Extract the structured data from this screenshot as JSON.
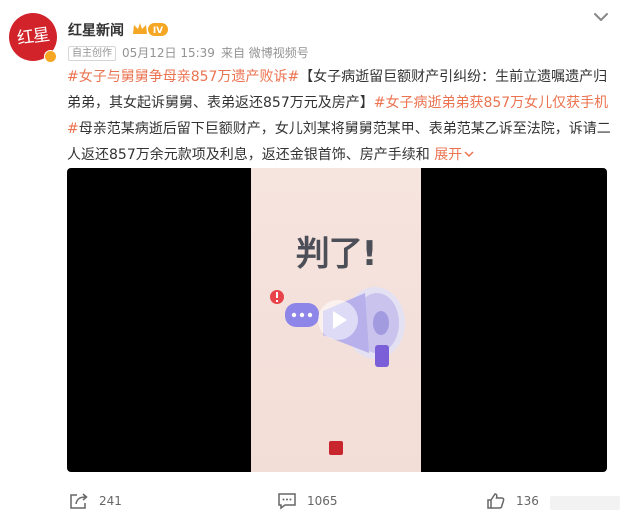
{
  "post": {
    "author": "红星新闻",
    "avatar_text": "红星",
    "vip_level": "IV",
    "original_tag": "自主创作",
    "time": "05月12日 15:39",
    "source": "来自 微博视频号",
    "content": {
      "tag1": "#女子与舅舅争母亲857万遗产败诉#",
      "text1": "【女子病逝留巨额财产引纠纷：生前立遗嘱遗产归弟弟，其女起诉舅舅、表弟返还857万元及房产】",
      "tag2": "#女子病逝弟弟获857万女儿仅获手机#",
      "text2": "母亲范某病逝后留下巨额财产，女儿刘某将舅舅范某甲、表弟范某乙诉至法院，诉请二人返还857万余元款项及利息，返还金银首饰、房产手续和",
      "expand": "展开"
    },
    "video": {
      "poster_title": "判了!"
    }
  },
  "actions": {
    "share_count": "241",
    "comment_count": "1065",
    "like_count": "136"
  },
  "colors": {
    "tag": "#eb7350",
    "avatar_bg": "#d2232a",
    "vip": "#f5a623"
  }
}
